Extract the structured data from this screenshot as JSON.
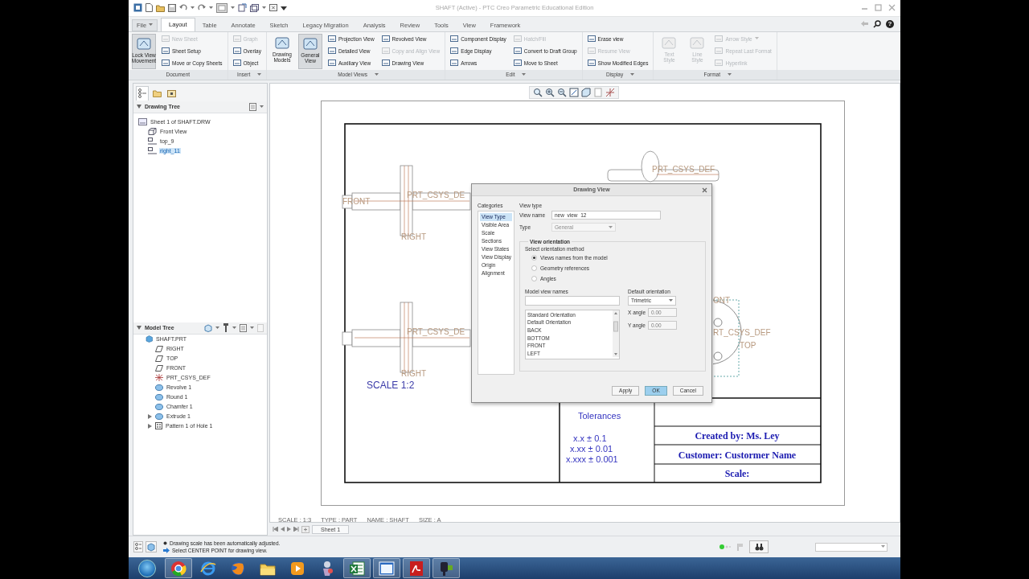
{
  "window": {
    "title": "SHAFT (Active) - PTC Creo Parametric Educational Edition"
  },
  "ribbon_tabs": [
    {
      "label": "File",
      "kind": "menu",
      "selected": false
    },
    {
      "label": "Layout",
      "kind": "tab",
      "selected": true
    },
    {
      "label": "Table",
      "kind": "tab",
      "selected": false
    },
    {
      "label": "Annotate",
      "kind": "tab",
      "selected": false
    },
    {
      "label": "Sketch",
      "kind": "tab",
      "selected": false
    },
    {
      "label": "Legacy Migration",
      "kind": "tab",
      "selected": false
    },
    {
      "label": "Analysis",
      "kind": "tab",
      "selected": false
    },
    {
      "label": "Review",
      "kind": "tab",
      "selected": false
    },
    {
      "label": "Tools",
      "kind": "tab",
      "selected": false
    },
    {
      "label": "View",
      "kind": "tab",
      "selected": false
    },
    {
      "label": "Framework",
      "kind": "tab",
      "selected": false
    }
  ],
  "help": "?",
  "ribbon_groups": [
    {
      "label": "Document",
      "menu": false,
      "columns": [
        [
          {
            "label": "Lock View Movement",
            "kind": "large",
            "disabled": false,
            "pressed": true
          }
        ],
        [
          {
            "label": "New Sheet",
            "kind": "small",
            "disabled": true,
            "pressed": false
          },
          {
            "label": "Sheet Setup",
            "kind": "small",
            "disabled": false,
            "pressed": false
          },
          {
            "label": "Move or Copy Sheets",
            "kind": "small",
            "disabled": false,
            "pressed": false
          }
        ]
      ]
    },
    {
      "label": "Insert",
      "menu": true,
      "columns": [
        [
          {
            "label": "Graph",
            "kind": "small",
            "disabled": true,
            "pressed": false
          },
          {
            "label": "Overlay",
            "kind": "small",
            "disabled": false,
            "pressed": false
          },
          {
            "label": "Object",
            "kind": "small",
            "disabled": false,
            "pressed": false
          }
        ]
      ]
    },
    {
      "label": "Model Views",
      "menu": true,
      "columns": [
        [
          {
            "label": "Drawing Models",
            "kind": "large",
            "disabled": false,
            "pressed": false
          }
        ],
        [
          {
            "label": "General View",
            "kind": "large",
            "disabled": false,
            "pressed": true
          }
        ],
        [
          {
            "label": "Projection View",
            "kind": "small",
            "disabled": false,
            "pressed": false
          },
          {
            "label": "Detailed View",
            "kind": "small",
            "disabled": false,
            "pressed": false
          },
          {
            "label": "Auxiliary View",
            "kind": "small",
            "disabled": false,
            "pressed": false
          }
        ],
        [
          {
            "label": "Revolved View",
            "kind": "small",
            "disabled": false,
            "pressed": false
          },
          {
            "label": "Copy and Align View",
            "kind": "small",
            "disabled": true,
            "pressed": false
          },
          {
            "label": "Drawing View",
            "kind": "small",
            "disabled": false,
            "pressed": false
          }
        ]
      ]
    },
    {
      "label": "Edit",
      "menu": true,
      "columns": [
        [
          {
            "label": "Component Display",
            "kind": "small",
            "disabled": false,
            "pressed": false
          },
          {
            "label": "Edge Display",
            "kind": "small",
            "disabled": false,
            "pressed": false
          },
          {
            "label": "Arrows",
            "kind": "small",
            "disabled": false,
            "pressed": false
          }
        ],
        [
          {
            "label": "Hatch/Fill",
            "kind": "small",
            "disabled": true,
            "pressed": false
          },
          {
            "label": "Convert to Draft Group",
            "kind": "small",
            "disabled": false,
            "pressed": false
          },
          {
            "label": "Move to Sheet",
            "kind": "small",
            "disabled": false,
            "pressed": false
          }
        ]
      ]
    },
    {
      "label": "Display",
      "menu": true,
      "columns": [
        [
          {
            "label": "Erase view",
            "kind": "small",
            "disabled": false,
            "pressed": false
          },
          {
            "label": "Resume View",
            "kind": "small",
            "disabled": true,
            "pressed": false
          },
          {
            "label": "Show Modified Edges",
            "kind": "small",
            "disabled": false,
            "pressed": false
          }
        ]
      ]
    },
    {
      "label": "Format",
      "menu": true,
      "columns": [
        [
          {
            "label": "Text Style",
            "kind": "large",
            "disabled": true,
            "pressed": false
          }
        ],
        [
          {
            "label": "Line Style",
            "kind": "large",
            "disabled": true,
            "pressed": false
          }
        ],
        [
          {
            "label": "Arrow Style",
            "kind": "menu",
            "disabled": true,
            "pressed": false
          },
          {
            "label": "Repeat Last Format",
            "kind": "small",
            "disabled": true,
            "pressed": false
          },
          {
            "label": "Hyperlink",
            "kind": "small",
            "disabled": true,
            "pressed": false
          }
        ]
      ]
    }
  ],
  "navigator_tabs": [
    {
      "kind": "tree",
      "selected": true
    },
    {
      "kind": "folder",
      "selected": false
    },
    {
      "kind": "box",
      "selected": false
    }
  ],
  "drawing_tree": {
    "title": "Drawing Tree",
    "items": [
      {
        "label": "Sheet 1 of SHAFT.DRW",
        "kind": "sheet",
        "selected": false,
        "children": [
          {
            "label": "Front View",
            "kind": "general-view",
            "selected": false
          },
          {
            "label": "top_9",
            "kind": "view",
            "selected": false
          },
          {
            "label": "right_11",
            "kind": "view",
            "selected": true
          }
        ]
      }
    ]
  },
  "model_tree": {
    "title": "Model Tree",
    "items": [
      {
        "label": "SHAFT.PRT",
        "kind": "part",
        "collapsed": false,
        "children": [
          {
            "label": "RIGHT",
            "kind": "plane",
            "collapsed": false
          },
          {
            "label": "TOP",
            "kind": "plane",
            "collapsed": false
          },
          {
            "label": "FRONT",
            "kind": "plane",
            "collapsed": false
          },
          {
            "label": "PRT_CSYS_DEF",
            "kind": "csys",
            "collapsed": false
          },
          {
            "label": "Revolve 1",
            "kind": "feature",
            "collapsed": false
          },
          {
            "label": "Round 1",
            "kind": "feature",
            "collapsed": false
          },
          {
            "label": "Chamfer 1",
            "kind": "feature",
            "collapsed": false
          },
          {
            "label": "Extrude 1",
            "kind": "feature",
            "collapsed": true
          },
          {
            "label": "Pattern 1 of Hole 1",
            "kind": "pattern",
            "collapsed": true
          }
        ]
      }
    ]
  },
  "drawing": {
    "views": [
      {
        "kind": "side",
        "left_label": "FRONT",
        "csys_label": "PRT_CSYS_DE",
        "bottom_label": "RIGHT"
      },
      {
        "kind": "side",
        "csys_label": "PRT_CSYS_DE",
        "bottom_label": "RIGHT",
        "caption": "SCALE  1:2"
      },
      {
        "kind": "iso",
        "csys_label": "PRT_CSYS_DEF"
      },
      {
        "kind": "end",
        "top_label": "ONT",
        "csys_label": "RT_CSYS_DEF",
        "center_label": "TOP"
      }
    ],
    "tolerances": {
      "title": "Tolerances",
      "lines": [
        "x.x ± 0.1",
        "x.xx ± 0.01",
        "x.xxx ± 0.001"
      ]
    },
    "title_block": [
      "Created by: Ms. Ley",
      "Customer: Custormer Name",
      "Scale:"
    ]
  },
  "status_line": [
    "SCALE : 1:3",
    "TYPE : PART",
    "NAME : SHAFT",
    "SIZE : A"
  ],
  "sheet_tabs": [
    {
      "label": "Sheet 1",
      "selected": true
    }
  ],
  "dialog": {
    "title": "Drawing View",
    "categories_label": "Categories",
    "categories": [
      {
        "label": "View Type",
        "selected": true
      },
      {
        "label": "Visible Area",
        "selected": false
      },
      {
        "label": "Scale",
        "selected": false
      },
      {
        "label": "Sections",
        "selected": false
      },
      {
        "label": "View States",
        "selected": false
      },
      {
        "label": "View Display",
        "selected": false
      },
      {
        "label": "Origin",
        "selected": false
      },
      {
        "label": "Alignment",
        "selected": false
      }
    ],
    "section_title": "View type",
    "view_name": {
      "label": "View name",
      "value": "new_view_12"
    },
    "type": {
      "label": "Type",
      "value": "General",
      "disabled": true
    },
    "orientation": {
      "legend": "View orientation",
      "prompt": "Select orientation method",
      "methods": [
        {
          "label": "Views names from the model",
          "selected": true
        },
        {
          "label": "Geometry references",
          "selected": false
        },
        {
          "label": "Angles",
          "selected": false
        }
      ],
      "names_label": "Model view names",
      "names": [
        "Standard Orientation",
        "Default Orientation",
        "BACK",
        "BOTTOM",
        "FRONT",
        "LEFT"
      ],
      "default_label": "Default orientation",
      "default_value": "Trimetric",
      "x_angle": {
        "label": "X angle",
        "value": "0.00",
        "disabled": true
      },
      "y_angle": {
        "label": "Y angle",
        "value": "0.00",
        "disabled": true
      }
    },
    "buttons": [
      {
        "label": "Apply",
        "primary": false
      },
      {
        "label": "OK",
        "primary": true
      },
      {
        "label": "Cancel",
        "primary": false
      }
    ]
  },
  "messages": [
    {
      "kind": "info",
      "text": "Drawing scale has been automatically adjusted."
    },
    {
      "kind": "prompt",
      "text": "Select CENTER POINT for drawing view."
    }
  ],
  "taskbar": {
    "apps": [
      {
        "kind": "ring",
        "running": true
      },
      {
        "kind": "globe",
        "running": false
      },
      {
        "kind": "sphere",
        "running": false
      },
      {
        "kind": "folder",
        "running": false
      },
      {
        "kind": "play",
        "running": false
      },
      {
        "kind": "figure",
        "running": false
      },
      {
        "kind": "sheet",
        "running": true
      },
      {
        "kind": "window",
        "running": true
      },
      {
        "kind": "document",
        "running": true
      },
      {
        "kind": "tool",
        "running": true
      }
    ]
  }
}
